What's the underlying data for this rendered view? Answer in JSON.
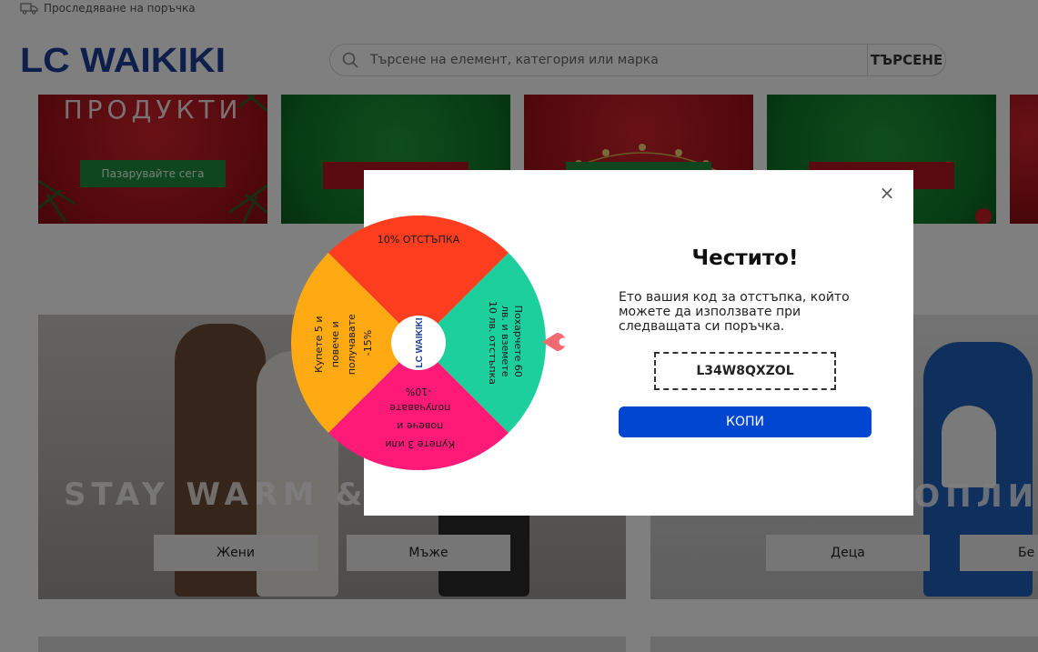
{
  "topbar": {
    "track_order": "Проследяване на поръчка"
  },
  "header": {
    "logo_text": "LC WAIKIKI"
  },
  "search": {
    "placeholder": "Търсене на елемент, категория или марка",
    "button": "ТЪРСЕНЕ"
  },
  "banners": [
    {
      "title": "ПРОДУКТИ",
      "button": "Пазарувайте сега"
    }
  ],
  "tiles": {
    "left": {
      "headline": "STAY WARM & ST",
      "buttons": [
        "Жени",
        "Мъже"
      ]
    },
    "right": {
      "headline": "ТОПЛИ И",
      "buttons": [
        "Деца",
        "Бе"
      ]
    }
  },
  "modal": {
    "close": "×",
    "title": "Честито!",
    "description": "Ето вашия код за отстъпка, който можете да използвате при следващата си поръчка.",
    "code": "L34W8QXZOL",
    "copy_button": "КОПИ"
  },
  "wheel": {
    "center_logo": "LC WAIKIKI",
    "segments": [
      {
        "label": "10% ОТСТЪПКА",
        "color": "#ff3d1f"
      },
      {
        "label": "Похарчете 60 лв. и вземете 10 лв. отстъпка",
        "color": "#1ecf9e"
      },
      {
        "label": "Купете 3 или повече и получавате -10%",
        "color": "#ff1a78"
      },
      {
        "label": "Купете 5 и повече и получавате -15%",
        "color": "#ffaa12"
      }
    ]
  },
  "colors": {
    "brand_blue": "#1b3e94",
    "copy_button": "#0046d1",
    "pointer": "#f06a72"
  }
}
